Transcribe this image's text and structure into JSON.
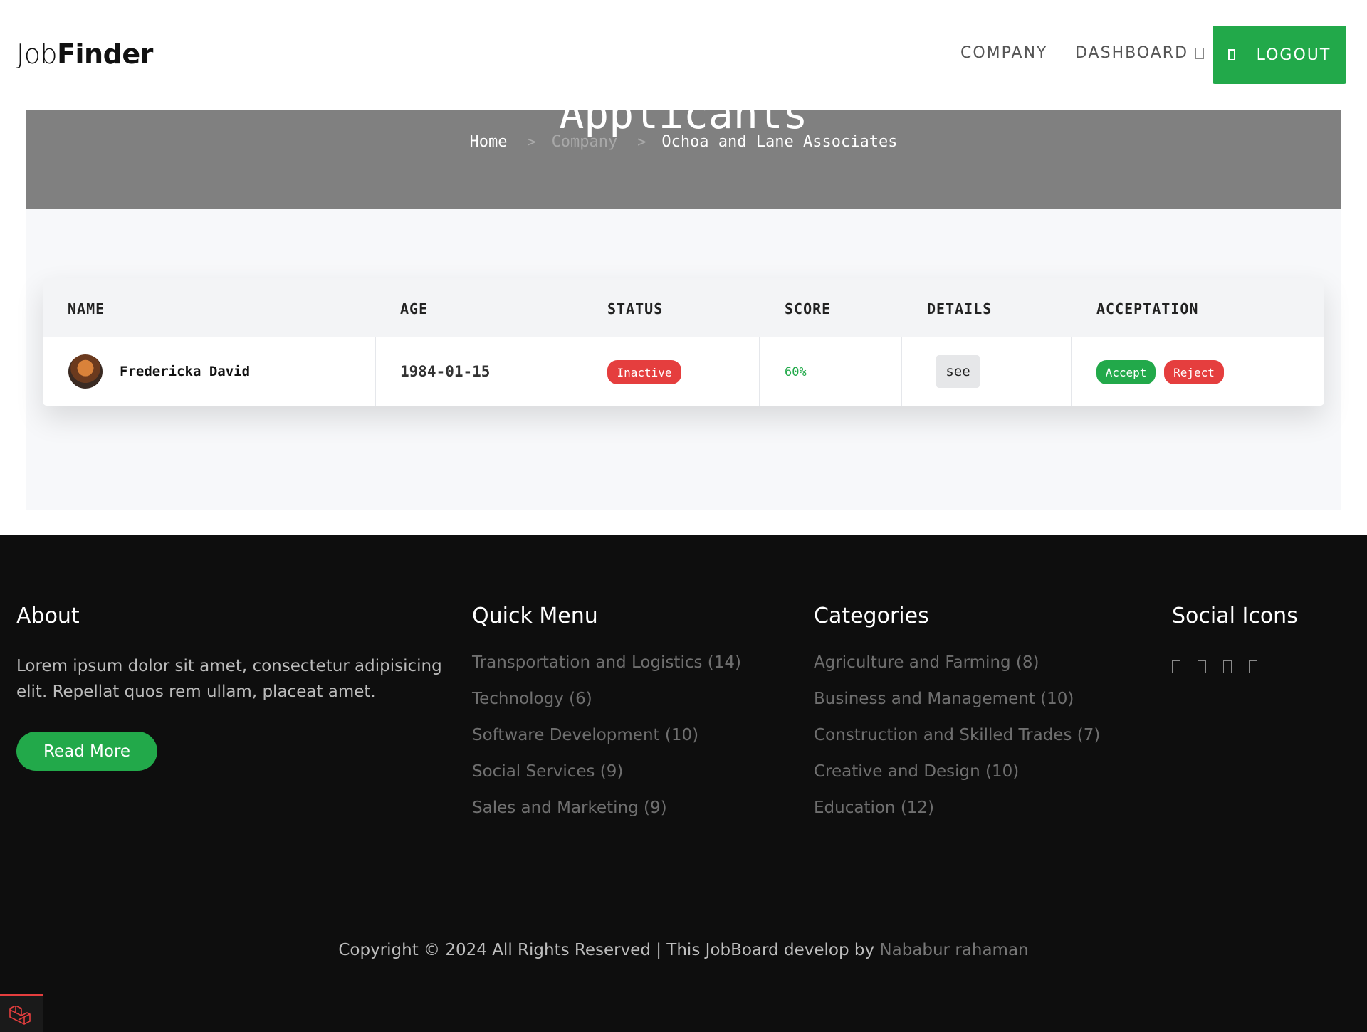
{
  "header": {
    "logo_light": "Job",
    "logo_bold": "Finder",
    "nav": {
      "company": "COMPANY",
      "dashboard": "DASHBOARD",
      "logout": "LOGOUT"
    }
  },
  "banner": {
    "title": "Applicants",
    "breadcrumb": {
      "home": "Home",
      "company": "Company",
      "current": "Ochoa and Lane Associates",
      "separator": ">"
    }
  },
  "table": {
    "headers": [
      "NAME",
      "AGE",
      "STATUS",
      "SCORE",
      "DETAILS",
      "ACCEPTATION"
    ],
    "rows": [
      {
        "name": "Fredericka David",
        "age": "1984-01-15",
        "status": "Inactive",
        "score": "60%",
        "details": "see",
        "accept": "Accept",
        "reject": "Reject"
      }
    ]
  },
  "footer": {
    "about": {
      "heading": "About",
      "text": "Lorem ipsum dolor sit amet, consectetur adipisicing elit. Repellat quos rem ullam, placeat amet.",
      "button": "Read More"
    },
    "quick_menu": {
      "heading": "Quick Menu",
      "items": [
        "Transportation and Logistics (14)",
        "Technology (6)",
        "Software Development (10)",
        "Social Services (9)",
        "Sales and Marketing (9)"
      ]
    },
    "categories": {
      "heading": "Categories",
      "items": [
        "Agriculture and Farming (8)",
        "Business and Management (10)",
        "Construction and Skilled Trades (7)",
        "Creative and Design (10)",
        "Education (12)"
      ]
    },
    "social": {
      "heading": "Social Icons",
      "icons": [
        "facebook-icon",
        "twitter-icon",
        "instagram-icon",
        "linkedin-icon"
      ]
    },
    "copyright": {
      "text": "Copyright © 2024 All Rights Reserved | This JobBoard develop by ",
      "author": "Nababur rahaman"
    }
  },
  "colors": {
    "accent": "#22a94a",
    "danger": "#e53e3e",
    "banner": "#808080",
    "footer": "#0e0e0e"
  }
}
